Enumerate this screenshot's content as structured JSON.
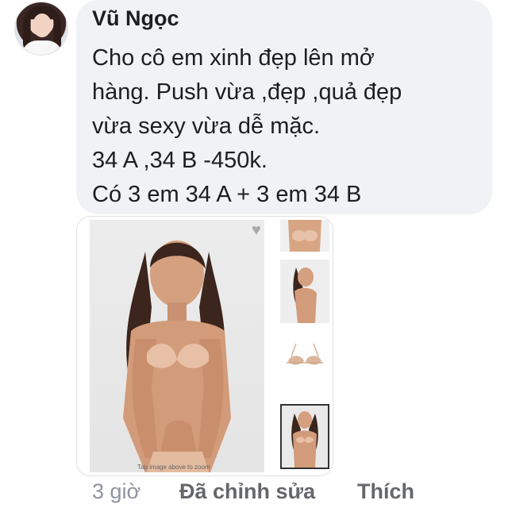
{
  "comment": {
    "author": "Vũ Ngọc",
    "lines": [
      "Cho cô em xinh đẹp lên mở",
      "hàng. Push vừa ,đẹp ,quả đẹp",
      "vừa sexy vừa dễ mặc.",
      "34 A ,34 B -450k.",
      "Có 3 em 34 A + 3 em 34 B"
    ]
  },
  "attachment": {
    "caption": "Tap image above to zoom"
  },
  "footer": {
    "time": "3 giờ",
    "edited_label": "Đã chỉnh sửa",
    "like_label": "Thích"
  },
  "colors": {
    "bubble": "#f0f2f5",
    "text": "#1c1e21",
    "meta": "#65676b"
  }
}
